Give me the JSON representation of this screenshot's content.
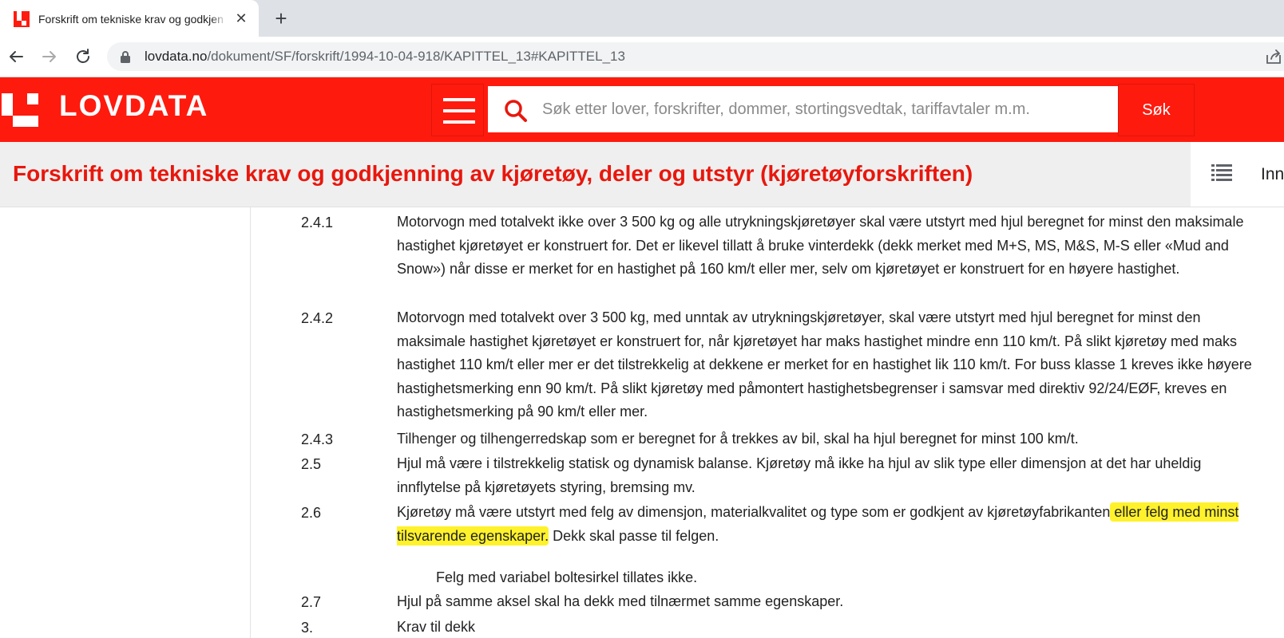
{
  "browser": {
    "tab_title": "Forskrift om tekniske krav og godkjenning av kjøretøy",
    "url_host": "lovdata.no",
    "url_path": "/dokument/SF/forskrift/1994-10-04-918/KAPITTEL_13#KAPITTEL_13"
  },
  "header": {
    "logo_text": "LOVDATA",
    "search_placeholder": "Søk etter lover, forskrifter, dommer, stortingsvedtak, tariffavtaler m.m.",
    "search_button": "Søk"
  },
  "doc": {
    "title": "Forskrift om tekniske krav og godkjenning av kjøretøy, deler og utstyr (kjøretøyforskriften)",
    "toc_label": "Innhold"
  },
  "content": {
    "items": [
      {
        "num": "2.4.1",
        "text": "Motorvogn med totalvekt ikke over 3 500 kg og alle utrykningskjøretøyer skal være utstyrt med hjul beregnet for minst den maksimale hastighet kjøretøyet er konstruert for. Det er likevel tillatt å bruke vinterdekk (dekk merket med M+S, MS, M&S, M-S eller «Mud and Snow») når disse er merket for en hastighet på 160 km/t eller mer, selv om kjøretøyet er konstruert for en høyere hastighet."
      },
      {
        "num": "2.4.2",
        "text": "Motorvogn med totalvekt over 3 500 kg, med unntak av utrykningskjøretøyer, skal være utstyrt med hjul beregnet for minst den maksimale hastighet kjøretøyet er konstruert for, når kjøretøyet har maks hastighet mindre enn 110 km/t. På slikt kjøretøy med maks hastighet 110 km/t eller mer er det tilstrekkelig at dekkene er merket for en hastighet lik 110 km/t. For buss klasse 1 kreves ikke høyere hastighetsmerking enn 90 km/t. På slikt kjøretøy med påmontert hastighetsbegrenser i samsvar med direktiv 92/24/EØF, kreves en hastighetsmerking på 90 km/t eller mer."
      },
      {
        "num": "2.4.3",
        "text": "Tilhenger og tilhengerredskap som er beregnet for å trekkes av bil, skal ha hjul beregnet for minst 100 km/t."
      },
      {
        "num": "2.5",
        "text": "Hjul må være i tilstrekkelig statisk og dynamisk balanse. Kjøretøy må ikke ha hjul av slik type eller dimensjon at det har uheldig innflytelse på kjøretøyets styring, bremsing mv."
      },
      {
        "num": "2.6",
        "text_before": "Kjøretøy må være utstyrt med felg av dimensjon, materialkvalitet og type som er godkjent av kjøretøyfabrikanten",
        "text_highlight": " eller felg med minst tilsvarende egenskaper.",
        "text_after": " Dekk skal passe til felgen."
      },
      {
        "indent_text": "Felg med variabel boltesirkel tillates ikke."
      },
      {
        "num": "2.7",
        "text": "Hjul på samme aksel skal ha dekk med tilnærmet samme egenskaper."
      },
      {
        "num": "3.",
        "text": "Krav til dekk"
      }
    ]
  },
  "colors": {
    "brand_red": "#ff1a0e",
    "title_red": "#e8170d",
    "highlight": "#fff22b"
  }
}
